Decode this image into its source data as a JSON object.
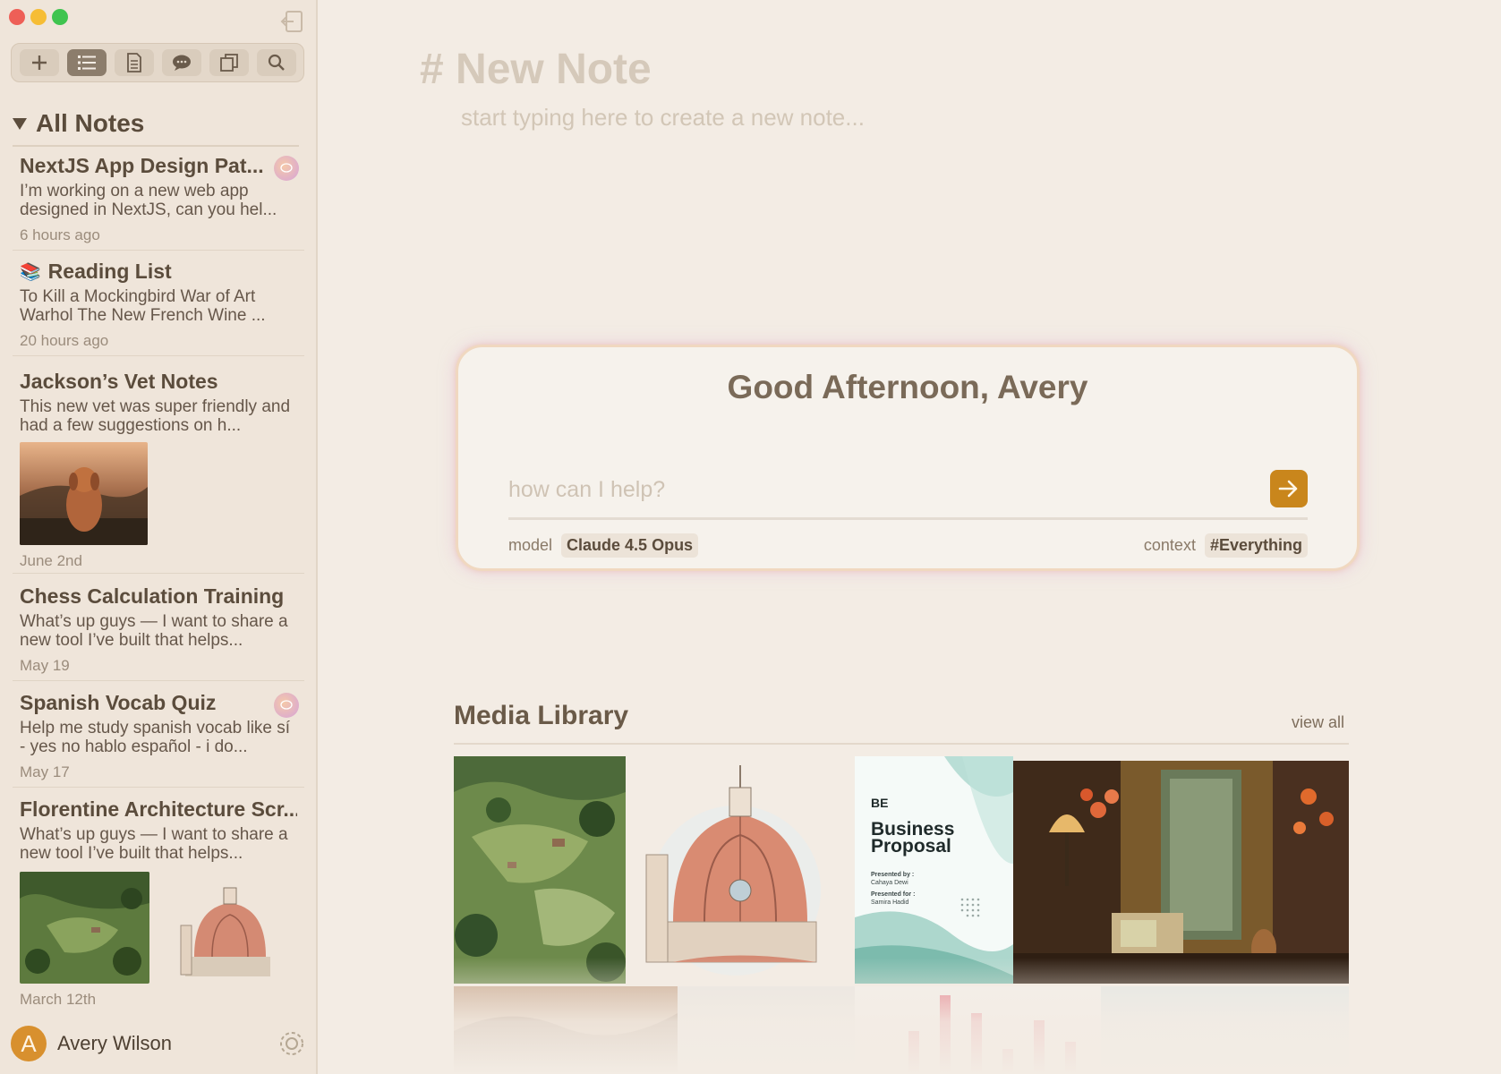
{
  "window": {
    "controls": [
      "close",
      "minimize",
      "zoom"
    ]
  },
  "toolbar": {
    "buttons": [
      {
        "icon": "plus-icon",
        "active": false
      },
      {
        "icon": "list-icon",
        "active": true
      },
      {
        "icon": "document-icon",
        "active": false
      },
      {
        "icon": "chat-icon",
        "active": false
      },
      {
        "icon": "copy-icon",
        "active": false
      },
      {
        "icon": "search-icon",
        "active": false
      }
    ]
  },
  "sidebar": {
    "section_title": "All Notes",
    "notes": [
      {
        "title": "NextJS App Design Pat...",
        "body": "I’m working on a new web app designed in NextJS, can you hel...",
        "date": "6 hours ago",
        "has_chat": true
      },
      {
        "emoji": "📚",
        "title": "Reading List",
        "body": "To Kill a Mockingbird War of Art Warhol The New French Wine ...",
        "date": "20 hours ago"
      },
      {
        "title": "Jackson’s Vet Notes",
        "body": "This new vet was super friendly and had a few suggestions on h...",
        "date": "June 2nd",
        "thumbnails": [
          "dog-photo"
        ]
      },
      {
        "title": "Chess Calculation Training",
        "body": "What’s up guys — I want to share a new tool I’ve built that helps...",
        "date": "May 19"
      },
      {
        "title": "Spanish Vocab Quiz",
        "body": "Help me study spanish vocab like sí - yes no hablo español - i do...",
        "date": "May 17",
        "has_chat": true
      },
      {
        "title": "Florentine Architecture Scr...",
        "body": "What’s up guys — I want to share a new tool I’ve built that helps...",
        "date": "March 12th",
        "thumbnails": [
          "aerial-landscape",
          "duomo-sketch"
        ]
      }
    ],
    "user": {
      "initial": "A",
      "name": "Avery Wilson"
    }
  },
  "editor": {
    "title": "# New Note",
    "placeholder": "start typing here to create a new note..."
  },
  "assistant": {
    "greeting": "Good Afternoon, Avery",
    "input_placeholder": "how can I help?",
    "model_label": "model",
    "model_value": "Claude 4.5 Opus",
    "context_label": "context",
    "context_value": "#Everything"
  },
  "media_library": {
    "title": "Media Library",
    "view_all": "view all",
    "business_proposal": {
      "logo": "BE",
      "title_line1": "Business",
      "title_line2": "Proposal",
      "presented_by_label": "Presented by :",
      "presented_by": "Cahaya Dewi",
      "presented_for_label": "Presented for :",
      "presented_for": "Samira Hadid"
    }
  },
  "colors": {
    "accent": "#c9861c",
    "sidebar_bg": "#efe5da",
    "main_bg": "#f3ece4",
    "close": "#ee5f57",
    "minimize": "#f6bd35",
    "zoom": "#3fc44f"
  }
}
